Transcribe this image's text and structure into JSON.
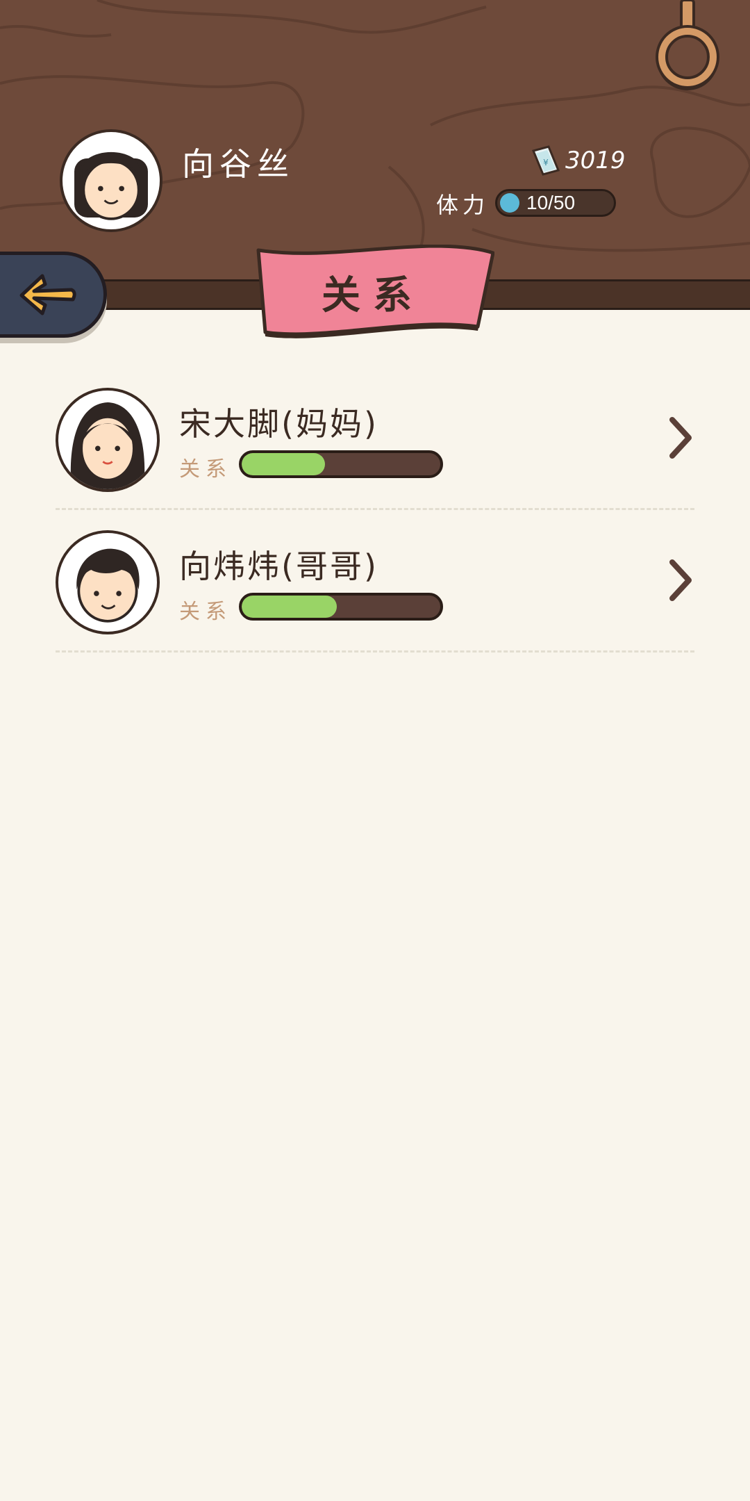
{
  "header": {
    "player_name": "向谷丝",
    "coins": "3019",
    "stamina_label": "体力",
    "stamina_value": "10/50",
    "stamina_level": 0.2
  },
  "nav": {
    "back_icon": "arrow-left-icon",
    "title": "关系"
  },
  "relations": [
    {
      "name": "宋大脚(妈妈)",
      "label": "关系",
      "level": 0.42,
      "avatar": "woman-long-hair"
    },
    {
      "name": "向炜炜(哥哥)",
      "label": "关系",
      "level": 0.48,
      "avatar": "boy-short-hair"
    }
  ],
  "colors": {
    "header_wood": "#6e4a3a",
    "ribbon_pink": "#f08497",
    "bar_green": "#99d466",
    "stamina_blue": "#5cbad8",
    "page_bg": "#f9f5ec"
  }
}
